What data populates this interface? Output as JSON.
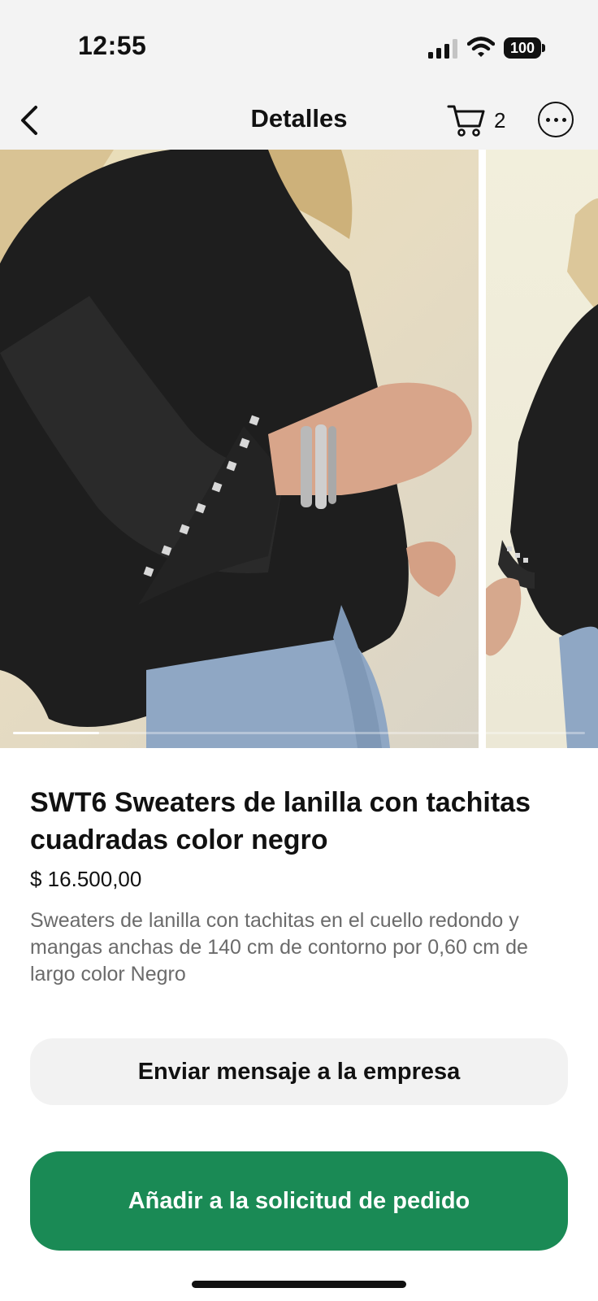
{
  "status_bar": {
    "time": "12:55",
    "battery_level": "100",
    "icons": [
      "signal-icon",
      "wifi-icon",
      "battery-icon"
    ]
  },
  "nav": {
    "title": "Detalles",
    "cart_count": "2",
    "icons": [
      "back-chevron-icon",
      "cart-icon",
      "more-options-icon"
    ]
  },
  "gallery": {
    "image_count_visible": 2,
    "progress_fraction": 0.15,
    "images": [
      {
        "name": "product-photo-1",
        "description_icon": "product-image"
      },
      {
        "name": "product-photo-2",
        "description_icon": "product-image"
      }
    ]
  },
  "product": {
    "title": "SWT6 Sweaters de lanilla con tachitas cuadradas color negro",
    "price": "$ 16.500,00",
    "description": "Sweaters de lanilla con tachitas en el cuello redondo y mangas anchas de 140 cm de contorno por 0,60 cm de largo color Negro"
  },
  "actions": {
    "message_label": "Enviar mensaje a la empresa",
    "add_label": "Añadir a la solicitud de pedido"
  },
  "colors": {
    "accent_green": "#1a8a55",
    "secondary_button_bg": "#f2f2f2",
    "description_text": "#6b6b6b",
    "top_bar_bg": "#f3f3f3"
  }
}
